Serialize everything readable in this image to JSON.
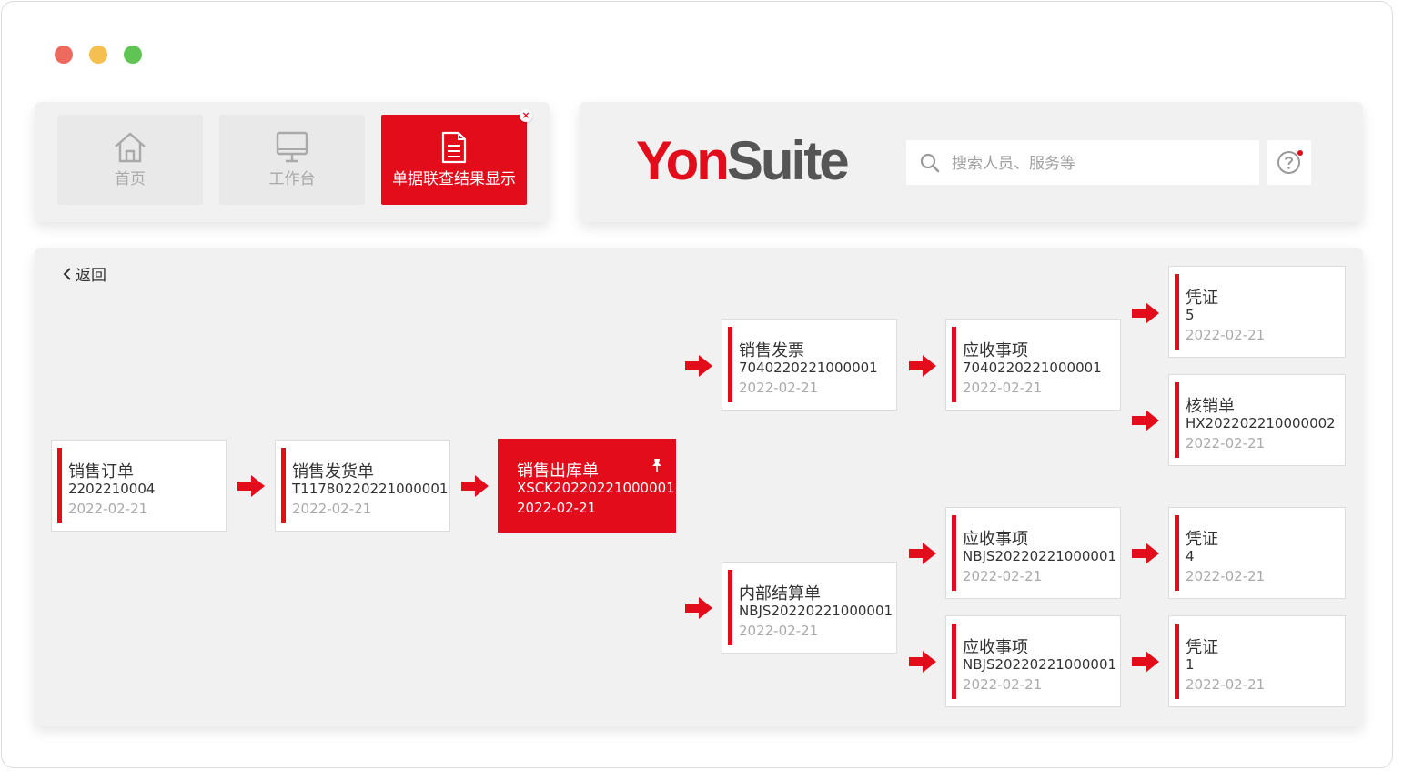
{
  "tabs": [
    {
      "label": "首页",
      "icon": "home-icon"
    },
    {
      "label": "工作台",
      "icon": "monitor-icon"
    },
    {
      "label": "单据联查结果显示",
      "icon": "document-icon",
      "active": true
    }
  ],
  "header": {
    "logo_part1": "Yon",
    "logo_part2": "Suite",
    "search_placeholder": "搜索人员、服务等"
  },
  "main": {
    "back_label": "返回",
    "cards": [
      {
        "id": "sales-order",
        "title": "销售订单",
        "code": "2202210004",
        "date": "2022-02-21"
      },
      {
        "id": "sales-delivery",
        "title": "销售发货单",
        "code": "T11780220221000001",
        "date": "2022-02-21"
      },
      {
        "id": "sales-outbound",
        "title": "销售出库单",
        "code": "XSCK20220221000001",
        "date": "2022-02-21",
        "selected": true
      },
      {
        "id": "sales-invoice",
        "title": "销售发票",
        "code": "7040220221000001",
        "date": "2022-02-21"
      },
      {
        "id": "internal-settlement",
        "title": "内部结算单",
        "code": "NBJS20220221000001",
        "date": "2022-02-21"
      },
      {
        "id": "receivable-1",
        "title": "应收事项",
        "code": "7040220221000001",
        "date": "2022-02-21"
      },
      {
        "id": "receivable-2",
        "title": "应收事项",
        "code": "NBJS20220221000001",
        "date": "2022-02-21"
      },
      {
        "id": "receivable-3",
        "title": "应收事项",
        "code": "NBJS20220221000001",
        "date": "2022-02-21"
      },
      {
        "id": "voucher-5",
        "title": "凭证",
        "code": "5",
        "date": "2022-02-21"
      },
      {
        "id": "writeoff",
        "title": "核销单",
        "code": "HX202202210000002",
        "date": "2022-02-21"
      },
      {
        "id": "voucher-4",
        "title": "凭证",
        "code": "4",
        "date": "2022-02-21"
      },
      {
        "id": "voucher-1",
        "title": "凭证",
        "code": "1",
        "date": "2022-02-21"
      }
    ]
  },
  "colors": {
    "accent": "#e30c1b",
    "panel": "#f1f1f1"
  }
}
